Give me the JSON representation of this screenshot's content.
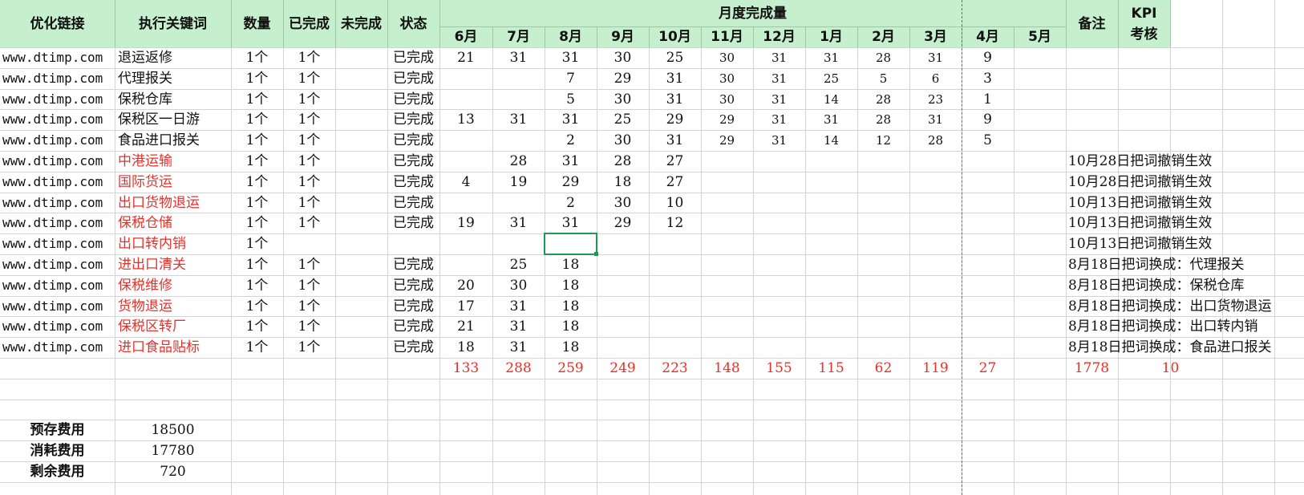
{
  "headers": {
    "link": "优化链接",
    "keyword": "执行关键词",
    "qty": "数量",
    "done": "已完成",
    "undone": "未完成",
    "status": "状态",
    "monthly": "月度完成量",
    "months": [
      "6月",
      "7月",
      "8月",
      "9月",
      "10月",
      "11月",
      "12月",
      "1月",
      "2月",
      "3月",
      "4月",
      "5月"
    ],
    "remark": "备注",
    "kpi": "KPI考核"
  },
  "rows": [
    {
      "link": "www.dtimp.com",
      "keyword": "退运返修",
      "red": false,
      "qty": "1个",
      "done": "1个",
      "status": "已完成",
      "m": [
        "21",
        "31",
        "31",
        "30",
        "25",
        "30",
        "31",
        "31",
        "28",
        "31",
        "9",
        ""
      ],
      "remark": ""
    },
    {
      "link": "www.dtimp.com",
      "keyword": "代理报关",
      "red": false,
      "qty": "1个",
      "done": "1个",
      "status": "已完成",
      "m": [
        "",
        "",
        "7",
        "29",
        "31",
        "30",
        "31",
        "25",
        "5",
        "6",
        "3",
        ""
      ],
      "remark": ""
    },
    {
      "link": "www.dtimp.com",
      "keyword": "保税仓库",
      "red": false,
      "qty": "1个",
      "done": "1个",
      "status": "已完成",
      "m": [
        "",
        "",
        "5",
        "30",
        "31",
        "30",
        "31",
        "14",
        "28",
        "23",
        "1",
        ""
      ],
      "remark": ""
    },
    {
      "link": "www.dtimp.com",
      "keyword": "保税区一日游",
      "red": false,
      "qty": "1个",
      "done": "1个",
      "status": "已完成",
      "m": [
        "13",
        "31",
        "31",
        "25",
        "29",
        "29",
        "31",
        "31",
        "28",
        "31",
        "9",
        ""
      ],
      "remark": ""
    },
    {
      "link": "www.dtimp.com",
      "keyword": "食品进口报关",
      "red": false,
      "qty": "1个",
      "done": "1个",
      "status": "已完成",
      "m": [
        "",
        "",
        "2",
        "30",
        "31",
        "29",
        "31",
        "14",
        "12",
        "28",
        "5",
        ""
      ],
      "remark": ""
    },
    {
      "link": "www.dtimp.com",
      "keyword": "中港运输",
      "red": true,
      "qty": "1个",
      "done": "1个",
      "status": "已完成",
      "m": [
        "",
        "28",
        "31",
        "28",
        "27",
        "",
        "",
        "",
        "",
        "",
        "",
        ""
      ],
      "remark": "10月28日把词撤销生效"
    },
    {
      "link": "www.dtimp.com",
      "keyword": "国际货运",
      "red": true,
      "qty": "1个",
      "done": "1个",
      "status": "已完成",
      "m": [
        "4",
        "19",
        "29",
        "18",
        "27",
        "",
        "",
        "",
        "",
        "",
        "",
        ""
      ],
      "remark": "10月28日把词撤销生效"
    },
    {
      "link": "www.dtimp.com",
      "keyword": "出口货物退运",
      "red": true,
      "qty": "1个",
      "done": "1个",
      "status": "已完成",
      "m": [
        "",
        "",
        "2",
        "30",
        "10",
        "",
        "",
        "",
        "",
        "",
        "",
        ""
      ],
      "remark": "10月13日把词撤销生效"
    },
    {
      "link": "www.dtimp.com",
      "keyword": "保税仓储",
      "red": true,
      "qty": "1个",
      "done": "1个",
      "status": "已完成",
      "m": [
        "19",
        "31",
        "31",
        "29",
        "12",
        "",
        "",
        "",
        "",
        "",
        "",
        ""
      ],
      "remark": "10月13日把词撤销生效"
    },
    {
      "link": "www.dtimp.com",
      "keyword": "出口转内销",
      "red": true,
      "qty": "1个",
      "done": "",
      "status": "",
      "m": [
        "",
        "",
        "",
        "",
        "",
        "",
        "",
        "",
        "",
        "",
        "",
        ""
      ],
      "remark": "10月13日把词撤销生效"
    },
    {
      "link": "www.dtimp.com",
      "keyword": "进出口清关",
      "red": true,
      "qty": "1个",
      "done": "1个",
      "status": "已完成",
      "m": [
        "",
        "25",
        "18",
        "",
        "",
        "",
        "",
        "",
        "",
        "",
        "",
        ""
      ],
      "remark": "8月18日把词换成：代理报关"
    },
    {
      "link": "www.dtimp.com",
      "keyword": "保税维修",
      "red": true,
      "qty": "1个",
      "done": "1个",
      "status": "已完成",
      "m": [
        "20",
        "30",
        "18",
        "",
        "",
        "",
        "",
        "",
        "",
        "",
        "",
        ""
      ],
      "remark": "8月18日把词换成：保税仓库"
    },
    {
      "link": "www.dtimp.com",
      "keyword": "货物退运",
      "red": true,
      "qty": "1个",
      "done": "1个",
      "status": "已完成",
      "m": [
        "17",
        "31",
        "18",
        "",
        "",
        "",
        "",
        "",
        "",
        "",
        "",
        ""
      ],
      "remark": "8月18日把词换成：出口货物退运"
    },
    {
      "link": "www.dtimp.com",
      "keyword": "保税区转厂",
      "red": true,
      "qty": "1个",
      "done": "1个",
      "status": "已完成",
      "m": [
        "21",
        "31",
        "18",
        "",
        "",
        "",
        "",
        "",
        "",
        "",
        "",
        ""
      ],
      "remark": "8月18日把词换成：出口转内销"
    },
    {
      "link": "www.dtimp.com",
      "keyword": "进口食品贴标",
      "red": true,
      "qty": "1个",
      "done": "1个",
      "status": "已完成",
      "m": [
        "18",
        "31",
        "18",
        "",
        "",
        "",
        "",
        "",
        "",
        "",
        "",
        ""
      ],
      "remark": "8月18日把词换成：食品进口报关"
    }
  ],
  "totals": {
    "months": [
      "133",
      "288",
      "259",
      "249",
      "223",
      "148",
      "155",
      "115",
      "62",
      "119",
      "27"
    ],
    "grand": "1778",
    "kpi": "10"
  },
  "costs": [
    {
      "label": "预存费用",
      "value": "18500"
    },
    {
      "label": "消耗费用",
      "value": "17780"
    },
    {
      "label": "剩余费用",
      "value": "720"
    }
  ],
  "colors": {
    "header_bg": "#c6efce",
    "red_text": "#e8302a",
    "selection": "#1e9b52",
    "grid": "#d4d4d4"
  }
}
